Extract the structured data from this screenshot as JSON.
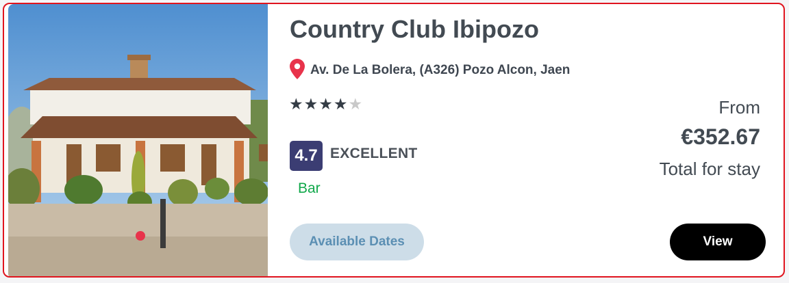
{
  "hotel": {
    "name": "Country Club Ibipozo",
    "address": "Av. De La Bolera, (A326) Pozo Alcon, Jaen",
    "star_rating": 4,
    "max_stars": 5,
    "review_score": "4.7",
    "review_label": "EXCELLENT",
    "amenity": "Bar"
  },
  "pricing": {
    "from_label": "From",
    "price": "€352.67",
    "total_label": "Total for stay"
  },
  "buttons": {
    "available_dates": "Available Dates",
    "view": "View"
  },
  "colors": {
    "card_border": "#e0141e",
    "rating_box": "#3b3d73",
    "amenity_text": "#10a84a",
    "pin": "#e8334b",
    "dates_button_bg": "#cddde8",
    "view_button_bg": "#000000"
  },
  "icons": {
    "location": "map-pin-icon",
    "rating": "star-icon"
  }
}
